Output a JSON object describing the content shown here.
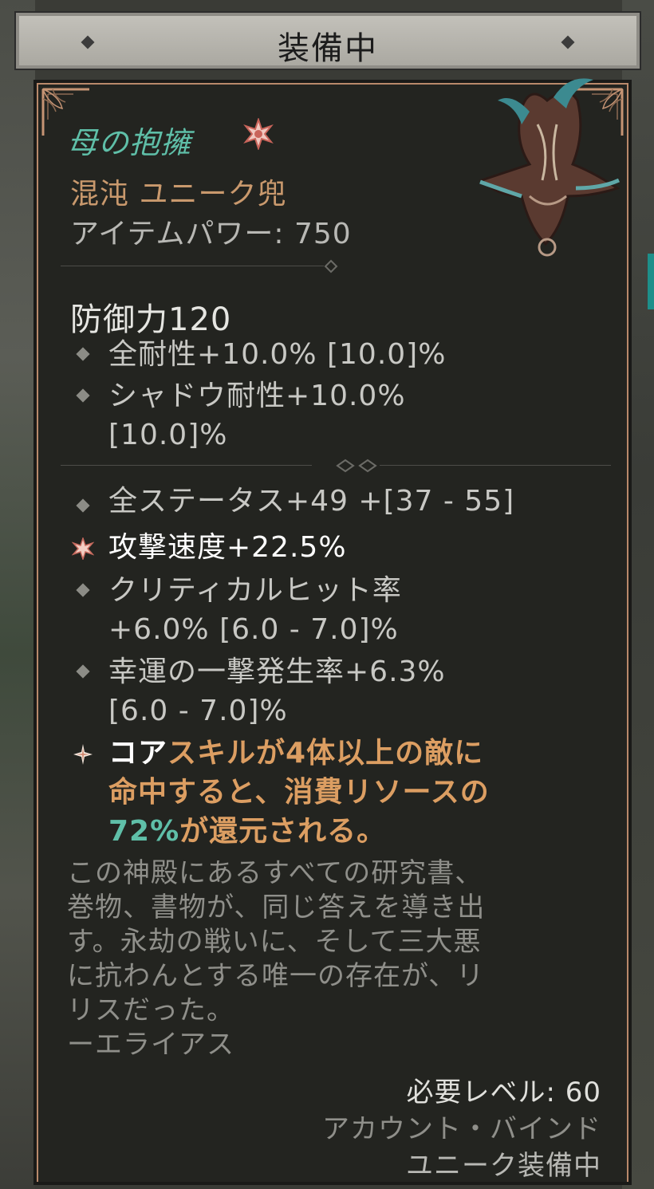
{
  "header": {
    "title": "装備中"
  },
  "item": {
    "name": "母の抱擁",
    "type": "混沌 ユニーク兜",
    "power_label": "アイテムパワー: 750",
    "defense": "防御力120",
    "image_icon": "helmet-icon"
  },
  "implicit_stats": [
    {
      "line1": "全耐性+10.0% [10.0]%"
    },
    {
      "line1": "シャドウ耐性+10.0%",
      "line2": "[10.0]%"
    }
  ],
  "affixes": [
    {
      "line1": "全ステータス+49 +[37 - 55]",
      "bullet": "diamond"
    },
    {
      "line1": "攻撃速度+22.5%",
      "bullet": "star",
      "highlight": true
    },
    {
      "line1": "クリティカルヒット率",
      "line2": "+6.0% [6.0 - 7.0]%",
      "bullet": "diamond"
    },
    {
      "line1": "幸運の一撃発生率+6.3%",
      "line2": "[6.0 - 7.0]%",
      "bullet": "diamond"
    }
  ],
  "unique_power": {
    "line1_white": "コア",
    "line1_orange": "スキルが4体以上の敵に",
    "line2": "命中すると、消費リソースの",
    "line3_teal": "72%",
    "line3_orange": "が還元される。"
  },
  "lore": {
    "lines": [
      "この神殿にあるすべての研究書、",
      "巻物、書物が、同じ答えを導き出",
      "す。永劫の戦いに、そして三大悪",
      "に抗わんとする唯一の存在が、リ",
      "リスだった。",
      "ーエライアス"
    ]
  },
  "footer": {
    "required_level": "必要レベル: 60",
    "binding": "アカウント・バインド",
    "status": "ユニーク装備中"
  },
  "colors": {
    "unique_name": "#5fbfa8",
    "item_type": "#c9996d",
    "orange_text": "#dc9e62",
    "border": "#b9896b"
  }
}
